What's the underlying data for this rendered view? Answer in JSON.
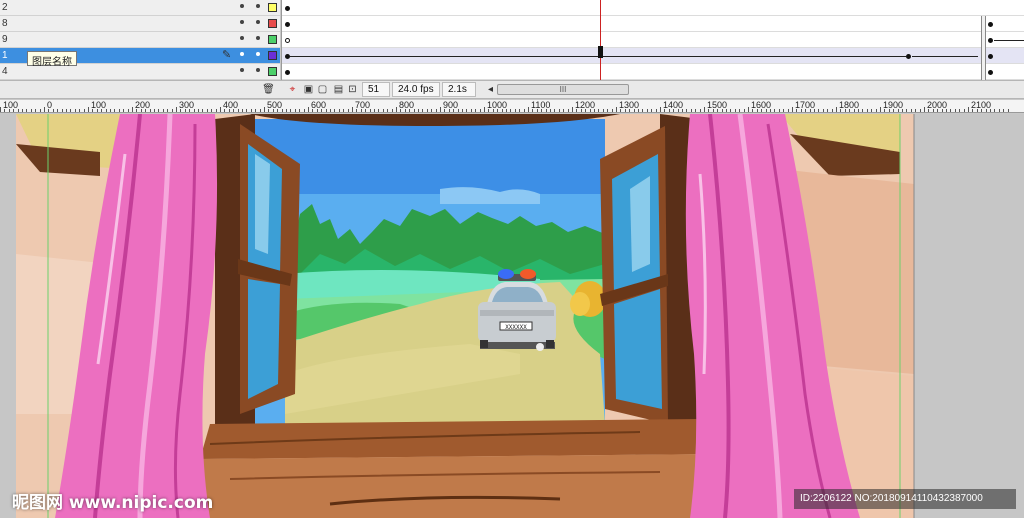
{
  "layers": [
    {
      "name": "2",
      "color": "#ffff66"
    },
    {
      "name": "8",
      "color": "#e74c4c"
    },
    {
      "name": "9",
      "color": "#4ccf6a"
    },
    {
      "name": "1",
      "color": "#6a2fd6",
      "selected": true,
      "tooltip": "图层名称"
    },
    {
      "name": "4",
      "color": "#4ccf6a"
    }
  ],
  "toolbar": {
    "frame": "51",
    "fps": "24.0 fps",
    "time": "2.1s",
    "scroll_glyph": "III",
    "scroll_left_glyph": "◂"
  },
  "ruler": {
    "labels": [
      "100",
      "0",
      "100",
      "200",
      "300",
      "400",
      "500",
      "600",
      "700",
      "800",
      "900",
      "1000",
      "1100",
      "1200",
      "1300",
      "1400",
      "1500",
      "1600",
      "1700",
      "1800",
      "1900",
      "2000",
      "2100"
    ]
  },
  "scene": {
    "license_plate": "XXXXXX"
  },
  "watermark": {
    "logo": "昵图网 www.nipic.com",
    "id": "ID:2206122 NO:20180914110432387000"
  },
  "icons": {
    "trash": "trash-icon",
    "pencil": "pencil-icon",
    "onion": "onion-skin-icon"
  }
}
